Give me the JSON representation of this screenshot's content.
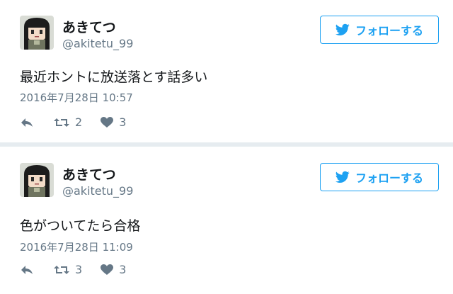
{
  "tweets": [
    {
      "display_name": "あきてつ",
      "handle": "@akitetu_99",
      "follow_label": "フォローする",
      "text": "最近ホントに放送落とす話多い",
      "timestamp": "2016年7月28日 10:57",
      "retweets": "2",
      "likes": "3"
    },
    {
      "display_name": "あきてつ",
      "handle": "@akitetu_99",
      "follow_label": "フォローする",
      "text": "色がついてたら合格",
      "timestamp": "2016年7月28日 11:09",
      "retweets": "3",
      "likes": "3"
    }
  ],
  "colors": {
    "accent": "#1da1f2",
    "muted": "#657786",
    "background": "#e6ecf0"
  },
  "icons": [
    "avatar",
    "twitter-bird-icon",
    "reply-icon",
    "retweet-icon",
    "heart-icon"
  ]
}
